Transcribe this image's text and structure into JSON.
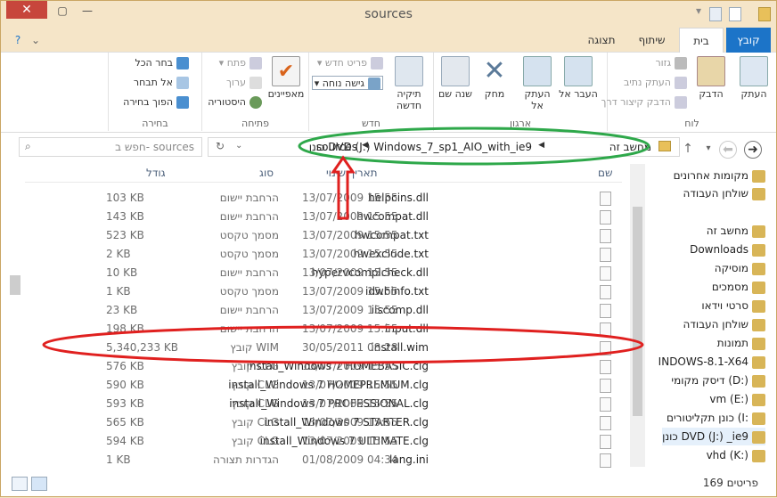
{
  "window": {
    "title": "sources"
  },
  "ribbon_tabs": [
    {
      "label": "קובץ"
    },
    {
      "label": "בית"
    },
    {
      "label": "שיתוף"
    },
    {
      "label": "תצוגה"
    }
  ],
  "ribbon": {
    "clipboard": {
      "label": "לוח",
      "copy": "העתק",
      "paste": "הדבק",
      "cut": "גזור",
      "copy_path": "העתק נתיב",
      "paste_shortcut": "הדבק קיצור דרך"
    },
    "organize": {
      "label": "ארגון",
      "move_to": "העבר אל",
      "copy_to": "העתק אל",
      "delete": "מחק",
      "rename": "שנה שם"
    },
    "new": {
      "label": "חדש",
      "new_folder": "תיקיה חדשה",
      "new_item": "פריט חדש",
      "easy_access": "גישה נוחה"
    },
    "open": {
      "label": "פתיחה",
      "properties": "מאפיינים",
      "open": "פתח",
      "edit": "ערוך",
      "history": "היסטוריה"
    },
    "select": {
      "label": "בחירה",
      "select_all": "בחר הכל",
      "select_none": "אל תבחר",
      "invert": "הפוך בחירה"
    }
  },
  "address": {
    "crumbs": [
      "מחשב זה",
      "כונן DVD (J:) Windows_7_sp1_AIO_with_ie9",
      "sources"
    ]
  },
  "search": {
    "placeholder": "חפש ב- sources"
  },
  "columns": {
    "name": "שם",
    "date": "תאריך שינוי",
    "type": "סוג",
    "size": "גודל"
  },
  "files": [
    {
      "name": "helpcins.dll",
      "date": "13/07/2009 15:55",
      "type": "הרחבת יישום",
      "size": "103 KB"
    },
    {
      "name": "hwcompat.dll",
      "date": "13/07/2009 15:55",
      "type": "הרחבת יישום",
      "size": "143 KB"
    },
    {
      "name": "hwcompat.txt",
      "date": "13/07/2009 15:55",
      "type": "מסמך טקסט",
      "size": "523 KB"
    },
    {
      "name": "hwexclude.txt",
      "date": "13/07/2009 15:55",
      "type": "מסמך טקסט",
      "size": "2 KB"
    },
    {
      "name": "hypervcomplcheck.dll",
      "date": "13/07/2009 15:55",
      "type": "הרחבת יישום",
      "size": "10 KB"
    },
    {
      "name": "idwbinfo.txt",
      "date": "13/07/2009 15:55",
      "type": "מסמך טקסט",
      "size": "1 KB"
    },
    {
      "name": "iiscomp.dll",
      "date": "13/07/2009 15:55",
      "type": "הרחבת יישום",
      "size": "23 KB"
    },
    {
      "name": "input.dll",
      "date": "13/07/2009 15:55",
      "type": "הרחבת יישום",
      "size": "198 KB"
    },
    {
      "name": "install.wim",
      "date": "30/05/2011 08:28",
      "type": "קובץ WIM",
      "size": "5,340,233 KB"
    },
    {
      "name": "install_Windows 7 HOMEBASIC.clg",
      "date": "13/07/2009 15:55",
      "type": "קובץ CLG",
      "size": "576 KB"
    },
    {
      "name": "install_Windows 7 HOMEPREMIUM.clg",
      "date": "13/07/2009 15:55",
      "type": "קובץ CLG",
      "size": "590 KB"
    },
    {
      "name": "install_Windows 7 PROFESSIONAL.clg",
      "date": "13/07/2009 15:55",
      "type": "קובץ CLG",
      "size": "593 KB"
    },
    {
      "name": "install_Windows 7 STARTER.clg",
      "date": "13/07/2009 15:55",
      "type": "קובץ CLG",
      "size": "565 KB"
    },
    {
      "name": "install_Windows 7 ULTIMATE.clg",
      "date": "13/07/2009 15:55",
      "type": "קובץ CLG",
      "size": "594 KB"
    },
    {
      "name": "lang.ini",
      "date": "01/08/2009 04:34",
      "type": "הגדרות תצורה",
      "size": "1 KB"
    }
  ],
  "nav_pane": [
    {
      "label": "מקומות אחרונים",
      "icon": "recent-places-icon"
    },
    {
      "label": "שולחן העבודה",
      "icon": "desktop-icon"
    },
    {
      "label": "מחשב זה",
      "icon": "computer-icon"
    },
    {
      "label": "Downloads",
      "icon": "downloads-icon"
    },
    {
      "label": "מוסיקה",
      "icon": "music-icon"
    },
    {
      "label": "מסמכים",
      "icon": "documents-icon"
    },
    {
      "label": "סרטי וידאו",
      "icon": "videos-icon"
    },
    {
      "label": "שולחן העבודה",
      "icon": "desktop-icon"
    },
    {
      "label": "תמונות",
      "icon": "pictures-icon"
    },
    {
      "label": "INDOWS-8.1-X64",
      "icon": "drive-icon"
    },
    {
      "label": "דיסק מקומי (D:)",
      "icon": "drive-icon"
    },
    {
      "label": "vm (E:)",
      "icon": "drive-icon"
    },
    {
      "label": "כונן תקליטורים (I:",
      "icon": "cd-drive-icon"
    },
    {
      "label": "כונן DVD (J:) _ie9",
      "icon": "dvd-drive-icon"
    },
    {
      "label": "vhd (K:)",
      "icon": "drive-icon"
    }
  ],
  "status": {
    "count": "169 פריטים"
  },
  "colors": {
    "annotation_green": "#2ea84a",
    "annotation_red": "#e0201f",
    "file_tab": "#1c74c8"
  }
}
